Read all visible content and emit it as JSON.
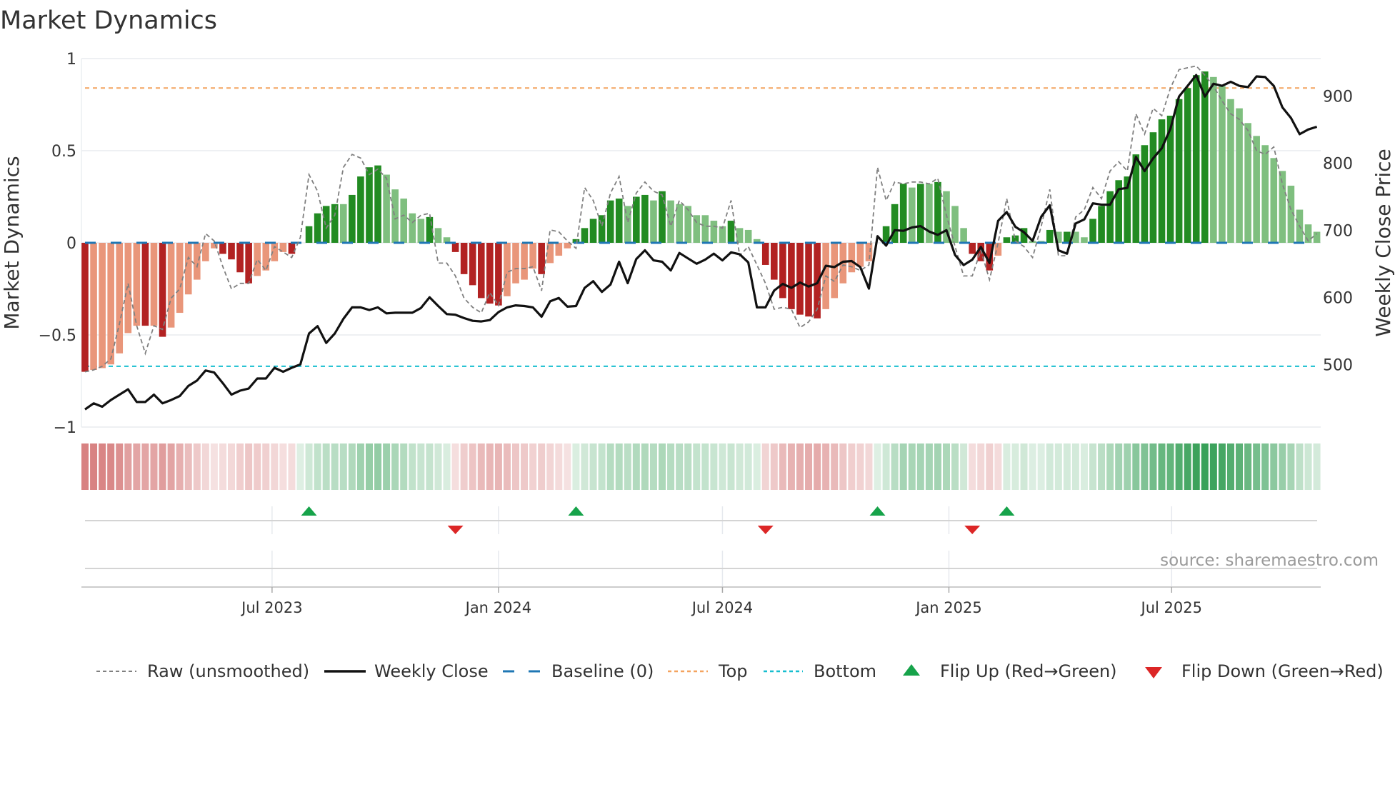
{
  "title": "Market Dynamics",
  "source": "source: sharemaestro.com",
  "chart_data": {
    "type": "bar",
    "title": "Market Dynamics",
    "start_date": "2023-01-30",
    "interval_days": 7,
    "dynamics": [
      -0.7,
      -0.69,
      -0.68,
      -0.66,
      -0.6,
      -0.49,
      -0.45,
      -0.45,
      -0.45,
      -0.51,
      -0.46,
      -0.38,
      -0.28,
      -0.2,
      -0.1,
      -0.03,
      -0.06,
      -0.09,
      -0.16,
      -0.22,
      -0.18,
      -0.15,
      -0.1,
      -0.05,
      -0.06,
      0.0,
      0.09,
      0.16,
      0.2,
      0.21,
      0.21,
      0.26,
      0.36,
      0.41,
      0.42,
      0.37,
      0.29,
      0.24,
      0.16,
      0.13,
      0.14,
      0.08,
      0.03,
      -0.05,
      -0.17,
      -0.23,
      -0.3,
      -0.33,
      -0.34,
      -0.29,
      -0.22,
      -0.2,
      -0.14,
      -0.17,
      -0.11,
      -0.07,
      -0.03,
      0.02,
      0.08,
      0.13,
      0.15,
      0.23,
      0.24,
      0.2,
      0.25,
      0.26,
      0.23,
      0.28,
      0.23,
      0.21,
      0.2,
      0.15,
      0.15,
      0.12,
      0.09,
      0.12,
      0.08,
      0.07,
      0.02,
      -0.12,
      -0.2,
      -0.3,
      -0.36,
      -0.39,
      -0.4,
      -0.41,
      -0.36,
      -0.3,
      -0.22,
      -0.16,
      -0.13,
      -0.1,
      0.0,
      0.09,
      0.21,
      0.32,
      0.3,
      0.32,
      0.32,
      0.33,
      0.28,
      0.2,
      0.08,
      -0.06,
      -0.1,
      -0.15,
      -0.07,
      0.03,
      0.04,
      0.08,
      0.01,
      0.01,
      0.07,
      0.06,
      0.06,
      0.06,
      0.03,
      0.13,
      0.2,
      0.28,
      0.34,
      0.36,
      0.48,
      0.53,
      0.6,
      0.67,
      0.69,
      0.78,
      0.84,
      0.91,
      0.93,
      0.9,
      0.85,
      0.78,
      0.73,
      0.65,
      0.58,
      0.53,
      0.46,
      0.39,
      0.31,
      0.18,
      0.1,
      0.06
    ],
    "bar_shade_runs": [
      [
        "R",
        1
      ],
      [
        "r",
        6
      ],
      [
        "R",
        1
      ],
      [
        "r",
        1
      ],
      [
        "R",
        1
      ],
      [
        "r",
        6
      ],
      [
        "R",
        4
      ],
      [
        "r",
        4
      ],
      [
        "R",
        1
      ],
      [
        "G",
        5
      ],
      [
        "g",
        1
      ],
      [
        "G",
        4
      ],
      [
        "g",
        5
      ],
      [
        "G",
        1
      ],
      [
        "g",
        2
      ],
      [
        "R",
        6
      ],
      [
        "r",
        4
      ],
      [
        "R",
        1
      ],
      [
        "r",
        3
      ],
      [
        "G",
        6
      ],
      [
        "g",
        1
      ],
      [
        "G",
        2
      ],
      [
        "g",
        1
      ],
      [
        "G",
        1
      ],
      [
        "g",
        7
      ],
      [
        "G",
        1
      ],
      [
        "g",
        3
      ],
      [
        "R",
        7
      ],
      [
        "r",
        6
      ],
      [
        "G",
        4
      ],
      [
        "g",
        1
      ],
      [
        "G",
        1
      ],
      [
        "g",
        1
      ],
      [
        "G",
        1
      ],
      [
        "g",
        3
      ],
      [
        "R",
        3
      ],
      [
        "r",
        1
      ],
      [
        "G",
        3
      ],
      [
        "g",
        2
      ],
      [
        "G",
        1
      ],
      [
        "g",
        1
      ],
      [
        "G",
        1
      ],
      [
        "g",
        2
      ],
      [
        "G",
        14
      ],
      [
        "g",
        13
      ]
    ],
    "raw": [
      -0.7,
      -0.69,
      -0.67,
      -0.63,
      -0.44,
      -0.22,
      -0.45,
      -0.6,
      -0.45,
      -0.47,
      -0.3,
      -0.25,
      -0.08,
      -0.13,
      0.05,
      0.01,
      -0.13,
      -0.25,
      -0.22,
      -0.22,
      -0.09,
      -0.15,
      -0.02,
      -0.05,
      -0.08,
      0.03,
      0.37,
      0.28,
      0.08,
      0.15,
      0.41,
      0.48,
      0.46,
      0.37,
      0.4,
      0.35,
      0.13,
      0.15,
      0.11,
      0.15,
      0.16,
      -0.11,
      -0.11,
      -0.18,
      -0.3,
      -0.35,
      -0.38,
      -0.27,
      -0.34,
      -0.16,
      -0.14,
      -0.14,
      -0.13,
      -0.26,
      0.07,
      0.06,
      0.01,
      -0.03,
      0.3,
      0.23,
      0.09,
      0.27,
      0.36,
      0.11,
      0.27,
      0.33,
      0.28,
      0.26,
      0.09,
      0.23,
      0.18,
      0.11,
      0.09,
      0.09,
      0.08,
      0.23,
      -0.07,
      -0.02,
      -0.12,
      -0.22,
      -0.36,
      -0.35,
      -0.36,
      -0.46,
      -0.43,
      -0.36,
      -0.18,
      -0.21,
      -0.12,
      -0.13,
      -0.15,
      -0.12,
      0.41,
      0.23,
      0.33,
      0.32,
      0.33,
      0.33,
      0.32,
      0.35,
      0.15,
      -0.02,
      -0.18,
      -0.18,
      -0.04,
      -0.2,
      0.0,
      0.24,
      0.01,
      -0.02,
      -0.08,
      0.09,
      0.29,
      -0.07,
      -0.07,
      0.14,
      0.18,
      0.3,
      0.24,
      0.39,
      0.44,
      0.39,
      0.7,
      0.59,
      0.73,
      0.69,
      0.84,
      0.94,
      0.95,
      0.96,
      0.91,
      0.85,
      0.77,
      0.7,
      0.67,
      0.61,
      0.5,
      0.48,
      0.52,
      0.32,
      0.18,
      0.09,
      0.01,
      0.05
    ],
    "weekly_close": [
      433,
      442,
      437,
      447,
      455,
      463,
      444,
      444,
      455,
      442,
      447,
      453,
      468,
      476,
      491,
      488,
      472,
      455,
      461,
      464,
      479,
      479,
      495,
      489,
      495,
      500,
      546,
      557,
      532,
      546,
      568,
      585,
      585,
      581,
      585,
      576,
      577,
      577,
      577,
      584,
      600,
      587,
      575,
      574,
      569,
      565,
      564,
      566,
      578,
      585,
      588,
      587,
      585,
      571,
      594,
      599,
      586,
      587,
      614,
      624,
      608,
      619,
      653,
      621,
      657,
      670,
      655,
      653,
      640,
      666,
      658,
      650,
      656,
      665,
      655,
      667,
      664,
      652,
      585,
      585,
      610,
      620,
      614,
      622,
      616,
      621,
      647,
      645,
      653,
      654,
      645,
      613,
      691,
      677,
      700,
      699,
      704,
      706,
      698,
      693,
      700,
      663,
      648,
      656,
      675,
      651,
      714,
      727,
      705,
      697,
      684,
      720,
      737,
      670,
      665,
      710,
      716,
      740,
      738,
      738,
      761,
      763,
      809,
      788,
      807,
      822,
      851,
      899,
      915,
      931,
      899,
      918,
      915,
      921,
      915,
      913,
      929,
      928,
      915,
      883,
      867,
      843,
      850,
      854
    ],
    "baseline": 0,
    "top": 0.84,
    "bottom": -0.67,
    "flip_up_weeks": [
      27,
      58,
      93,
      108
    ],
    "flip_down_weeks": [
      44,
      80,
      104
    ],
    "y_left": {
      "label": "Market Dynamics",
      "range": [
        -1,
        1
      ],
      "ticks": [
        1,
        0.5,
        0,
        -0.5,
        -1
      ],
      "tick_labels": [
        "1",
        "0.5",
        "0",
        "−0.5",
        "−1"
      ]
    },
    "y_right": {
      "label": "Weekly Close Price",
      "range": [
        406.7,
        955.6
      ],
      "ticks": [
        900,
        800,
        700,
        600,
        500
      ],
      "tick_labels": [
        "900",
        "800",
        "700",
        "600",
        "500"
      ]
    },
    "x_ticks": [
      {
        "date": "2023-07-01",
        "label": "Jul 2023"
      },
      {
        "date": "2024-01-01",
        "label": "Jan 2024"
      },
      {
        "date": "2024-07-01",
        "label": "Jul 2024"
      },
      {
        "date": "2025-01-01",
        "label": "Jan 2025"
      },
      {
        "date": "2025-07-01",
        "label": "Jul 2025"
      }
    ],
    "grid": true,
    "legend_position": "bottom",
    "legend": {
      "raw": "Raw (unsmoothed)",
      "close": "Weekly Close",
      "baseline": "Baseline (0)",
      "top": "Top",
      "bottom": "Bottom",
      "flip_up": "Flip Up (Red→Green)",
      "flip_down": "Flip Down (Green→Red)"
    },
    "colors": {
      "neg_strong": "#b22222",
      "neg_weak": "#e9967a",
      "pos_strong": "#228b22",
      "pos_weak": "#7fbf7f",
      "raw": "#808080",
      "close": "#111111",
      "baseline": "#1f77b4",
      "top": "#f4a460",
      "bottom": "#17becf",
      "flip_up": "#16a34a",
      "flip_down": "#dc2626"
    }
  }
}
